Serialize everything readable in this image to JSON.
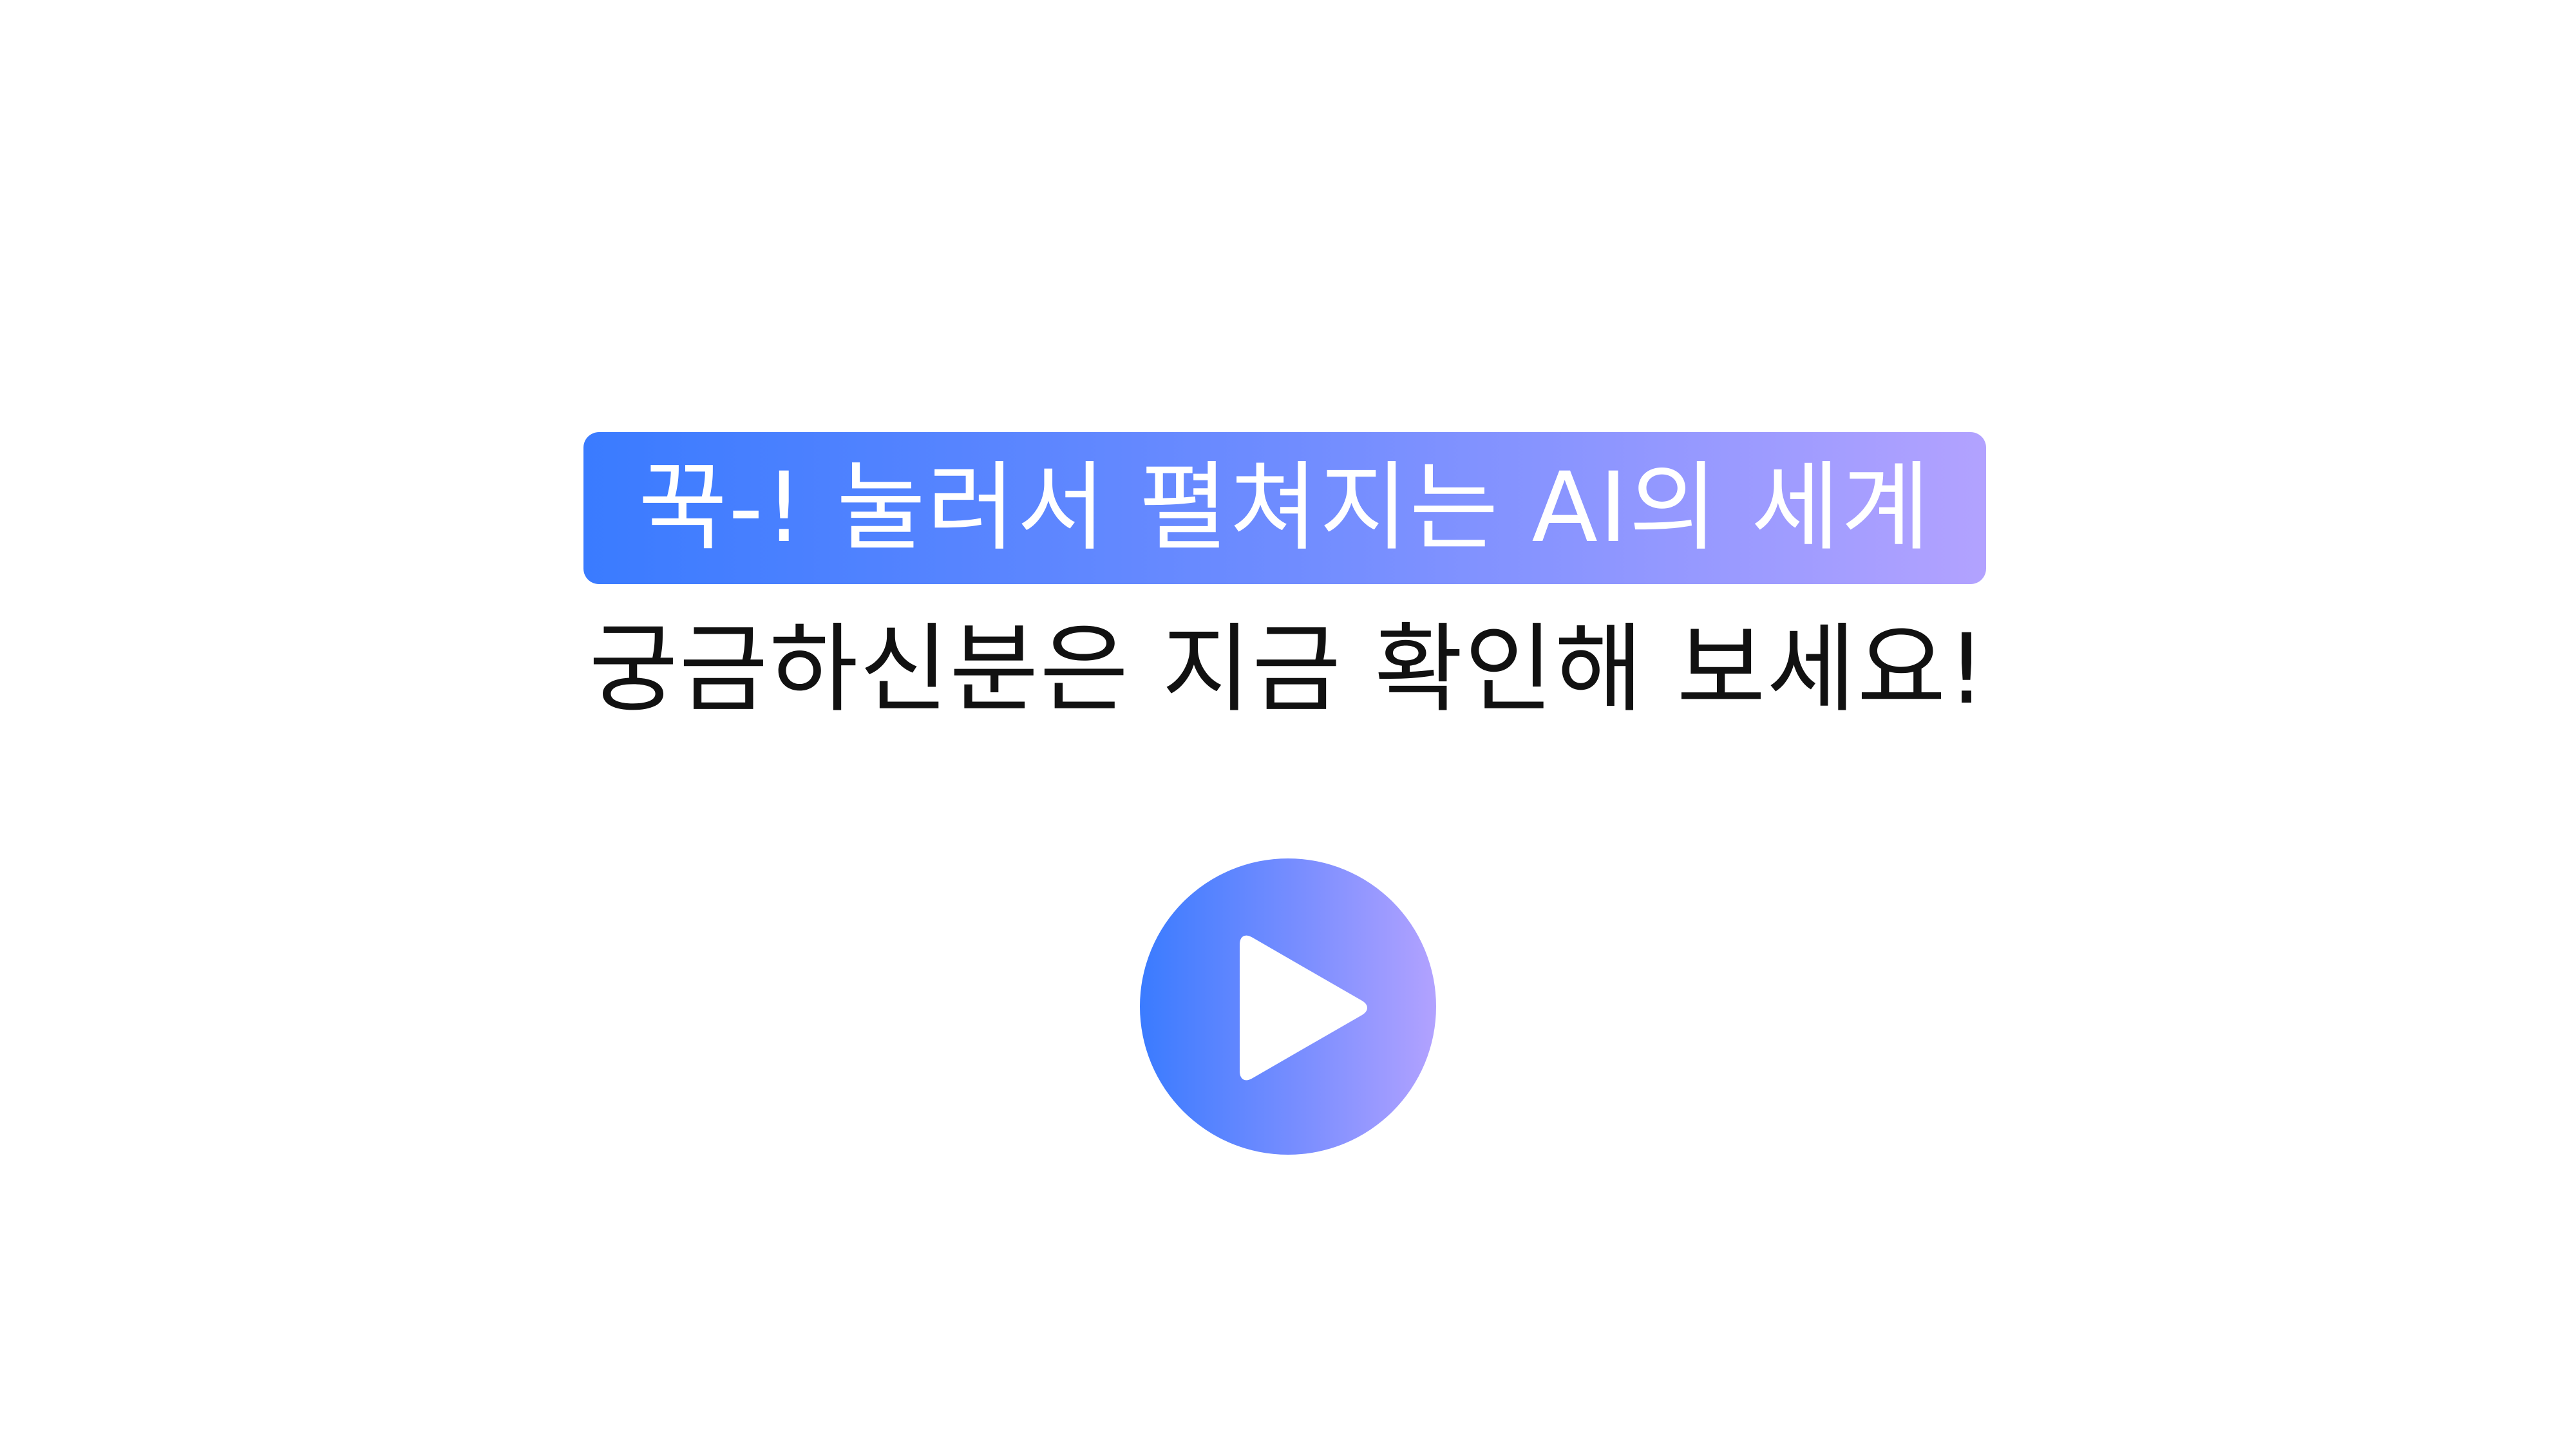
{
  "banner": {
    "headline": "꾹-! 눌러서 펼쳐지는 AI의 세계",
    "gradient_start": "#3a7bff",
    "gradient_end": "#b2a2ff"
  },
  "subtitle": "궁금하신분은 지금 확인해 보세요!",
  "play_button": {
    "icon": "play-icon",
    "color": "#3a7bff"
  }
}
